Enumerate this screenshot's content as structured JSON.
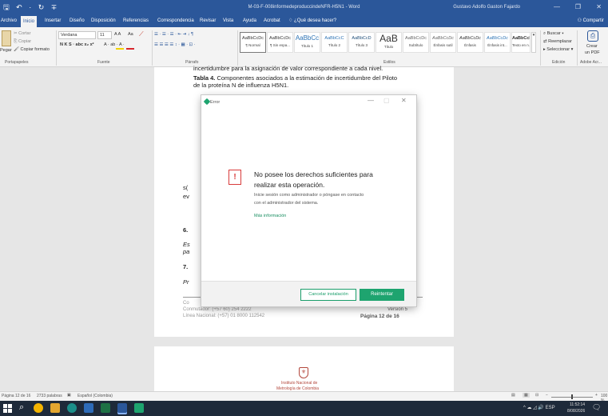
{
  "titlebar": {
    "qa_icons": "🖫 ↶ · ↻ ∓",
    "title": "M-03-F-008informedeproduccindeNFR-H5N1 - Word",
    "user": "Gustavo Adolfo Gaston Fajardo",
    "min": "—",
    "restore": "❐",
    "close": "✕"
  },
  "tabs": [
    "Archivo",
    "Inicio",
    "Insertar",
    "Diseño",
    "Disposición",
    "Referencias",
    "Correspondencia",
    "Revisar",
    "Vista",
    "Ayuda",
    "Acrobat"
  ],
  "tell_me": "¿Qué desea hacer?",
  "share": "Compartir",
  "ribbon": {
    "clipboard": {
      "cut": "Cortar",
      "copy": "Copiar",
      "painter": "Copiar formato",
      "paste": "Pegar",
      "label": "Portapapeles"
    },
    "font": {
      "name": "Verdana",
      "size": "11",
      "grow": "A A",
      "case": "Aa",
      "row2": "N K S · abc x₂ x²",
      "color_row": "A · ab · A ·",
      "label": "Fuente"
    },
    "paragraph": {
      "row1": "☰ · ☰ · ☰ · ⇤ ⇥  ↓ ¶",
      "row2": "☰ ☰ ☰ ☰  ↕ · ▦ · ⊡ ·",
      "label": "Párrafo"
    },
    "styles": {
      "items": [
        {
          "sample": "AaBbCcDc",
          "name": "¶ Normal"
        },
        {
          "sample": "AaBbCcDc",
          "name": "¶ Sin espa..."
        },
        {
          "sample": "AaBbCc",
          "name": "Título 1"
        },
        {
          "sample": "AaBbCcC",
          "name": "Título 2"
        },
        {
          "sample": "AaBbCcD",
          "name": "Título 3"
        },
        {
          "sample": "AaB",
          "name": "Título"
        },
        {
          "sample": "AaBbCcDc",
          "name": "Subtítulo"
        },
        {
          "sample": "AaBbCcDc",
          "name": "Énfasis sutil"
        },
        {
          "sample": "AaBbCcDc",
          "name": "Énfasis"
        },
        {
          "sample": "AaBbCcDc",
          "name": "Énfasis int..."
        },
        {
          "sample": "AaBbCcDc",
          "name": "Texto en n..."
        },
        {
          "sample": "AaBbCcDc",
          "name": ""
        }
      ],
      "label": "Estilos"
    },
    "editing": {
      "find": "Buscar",
      "replace": "Reemplazar",
      "select": "Seleccionar",
      "label": "Edición"
    },
    "adobe": {
      "create": "Crear",
      "pdf": "un PDF",
      "label": "Adobe Acr..."
    }
  },
  "document": {
    "line_top": "incertidumbre para la asignación de valor correspondiente a cada nivel.",
    "table_caption_bold": "Tabla 4.",
    "table_caption_rest": " Componentes asociados a la estimación de incertidumbre del Piloto",
    "table_caption_line2": "de la proteína N de influenza H5N1.",
    "frag1": "s(",
    "frag2": "ev",
    "frag3": "6.",
    "frag4": "Es",
    "frag5": "pa",
    "frag6": "7.",
    "frag7": "Pr",
    "footer_left1": "Co",
    "footer_left2": "Conmutador: (+57 60) 254 2222",
    "footer_left3": "Línea Nacional: (+57) 01 8000 112542",
    "footer_version": "Versión 5",
    "footer_page": "Página 12 de 16",
    "logo_line1": "Instituto Nacional de",
    "logo_line2": "Metrología de Colombia"
  },
  "dialog": {
    "title": "Error",
    "heading_line1": "No posee los derechos suficientes para",
    "heading_line2": "realizar esta operación.",
    "body_line1": "Inicie sesión como administrador o póngase en contacto",
    "body_line2": "con el administrador del sistema.",
    "link": "Más información",
    "cancel": "Cancelar instalación",
    "retry": "Reintentar",
    "min": "—",
    "max": "▢",
    "close": "✕"
  },
  "statusbar": {
    "page": "Página 12 de 16",
    "words": "2733 palabras",
    "lang": "Español (Colombia)",
    "zoom": "100 %"
  },
  "taskbar": {
    "search_icon": "⌕",
    "tray": "^ ☁ ◿ 🔊 ESP",
    "time": "11:52:14",
    "date": "8/08/2026"
  },
  "colors": {
    "word_blue": "#2b579a",
    "error_red": "#d83b3b",
    "accent_green": "#1ea46f"
  }
}
